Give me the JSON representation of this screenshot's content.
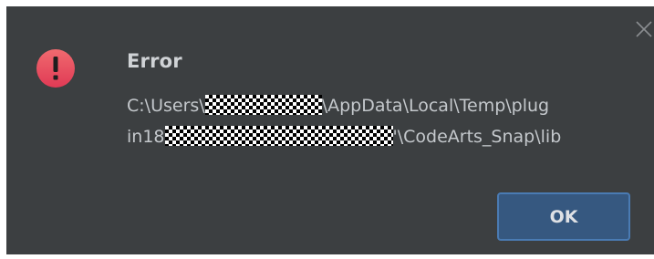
{
  "dialog": {
    "title": "Error",
    "icon": "error-exclamation-icon",
    "message_lines": [
      {
        "prefix": "C:\\Users\\",
        "suffix": "\\AppData\\Local\\Temp\\plug"
      },
      {
        "prefix": "in18",
        "suffix": "'\\CodeArts_Snap\\lib"
      }
    ],
    "ok_label": "OK",
    "close_icon": "close-icon"
  },
  "colors": {
    "background": "#3c3f41",
    "title_text": "#d0d3d6",
    "message_text": "#c4c8cc",
    "error_icon": "#e8455a",
    "ok_button": "#365880",
    "ok_button_border": "#4a7bb3"
  }
}
